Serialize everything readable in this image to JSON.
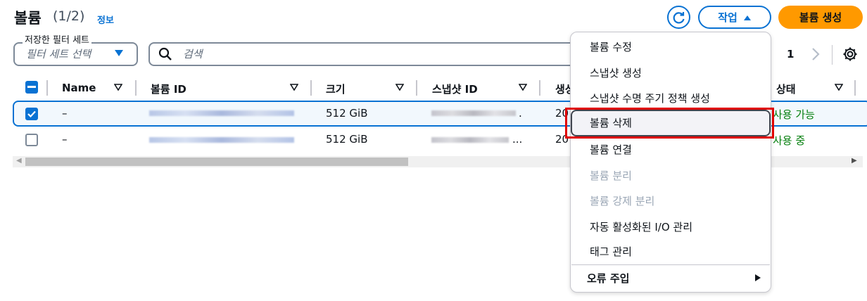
{
  "header": {
    "title": "볼륨",
    "count": "(1/2)",
    "info_link": "정보",
    "actions_label": "작업",
    "create_label": "볼륨 생성"
  },
  "filters": {
    "saved_filter_legend": "저장한 필터 세트",
    "saved_filter_placeholder": "필터 세트 선택",
    "search_placeholder": "검색"
  },
  "pagination": {
    "current_page": "1"
  },
  "table": {
    "columns": [
      "Name",
      "볼륨 ID",
      "크기",
      "스냅샷 ID",
      "생성",
      "상태"
    ],
    "rows": [
      {
        "selected": true,
        "name": "–",
        "size": "512 GiB",
        "snapshot_suffix": ".",
        "created": "20",
        "status": "사용 가능"
      },
      {
        "selected": false,
        "name": "–",
        "size": "512 GiB",
        "snapshot_suffix": "...",
        "created": "20",
        "status": "사용 중"
      }
    ]
  },
  "menu": {
    "items": [
      {
        "label": "볼륨 수정",
        "disabled": false
      },
      {
        "label": "스냅샷 생성",
        "disabled": false
      },
      {
        "label": "스냅샷 수명 주기 정책 생성",
        "disabled": false
      },
      {
        "label": "볼륨 삭제",
        "disabled": false,
        "highlighted": true
      },
      {
        "label": "볼륨 연결",
        "disabled": false
      },
      {
        "label": "볼륨 분리",
        "disabled": true
      },
      {
        "label": "볼륨 강제 분리",
        "disabled": true
      },
      {
        "label": "자동 활성화된 I/O 관리",
        "disabled": false
      },
      {
        "label": "태그 관리",
        "disabled": false
      }
    ],
    "submenu_label": "오류 주입"
  },
  "colors": {
    "accent": "#0972d3",
    "primary_button": "#ff9900",
    "status_ok": "#037f0c",
    "highlight_outline": "#e00000"
  },
  "icons": [
    "refresh-icon",
    "caret-up-icon",
    "caret-down-icon",
    "search-icon",
    "chevron-right-icon",
    "settings-icon",
    "sort-icon",
    "checkmark-icon",
    "submenu-arrow-icon"
  ]
}
